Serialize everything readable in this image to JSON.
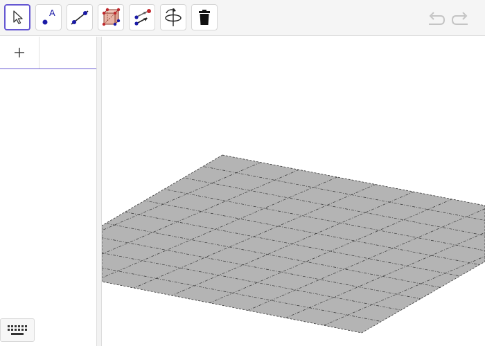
{
  "toolbar": {
    "tools": [
      {
        "name": "move-tool",
        "icon": "arrow-cursor-icon",
        "selected": true
      },
      {
        "name": "point-tool",
        "icon": "point-icon",
        "label": "A",
        "selected": false
      },
      {
        "name": "line-tool",
        "icon": "line-through-points-icon",
        "selected": false
      },
      {
        "name": "pyramid-tool",
        "icon": "polyhedron-icon",
        "selected": false
      },
      {
        "name": "vector-tool",
        "icon": "vector-icon",
        "selected": false
      },
      {
        "name": "rotate-view-tool",
        "icon": "rotate-3d-icon",
        "selected": false
      },
      {
        "name": "delete-tool",
        "icon": "trash-icon",
        "selected": false
      }
    ],
    "undo_icon": "undo-icon",
    "redo_icon": "redo-icon"
  },
  "algebra": {
    "input_plus_icon": "plus-icon",
    "keyboard_icon": "keyboard-icon"
  },
  "graphics3d": {
    "plane_color": "#b4b4b4",
    "grid_line_color": "#333333"
  },
  "colors": {
    "accent": "#6557d2",
    "point_blue": "#1a1aa6",
    "point_red": "#c0282d"
  }
}
